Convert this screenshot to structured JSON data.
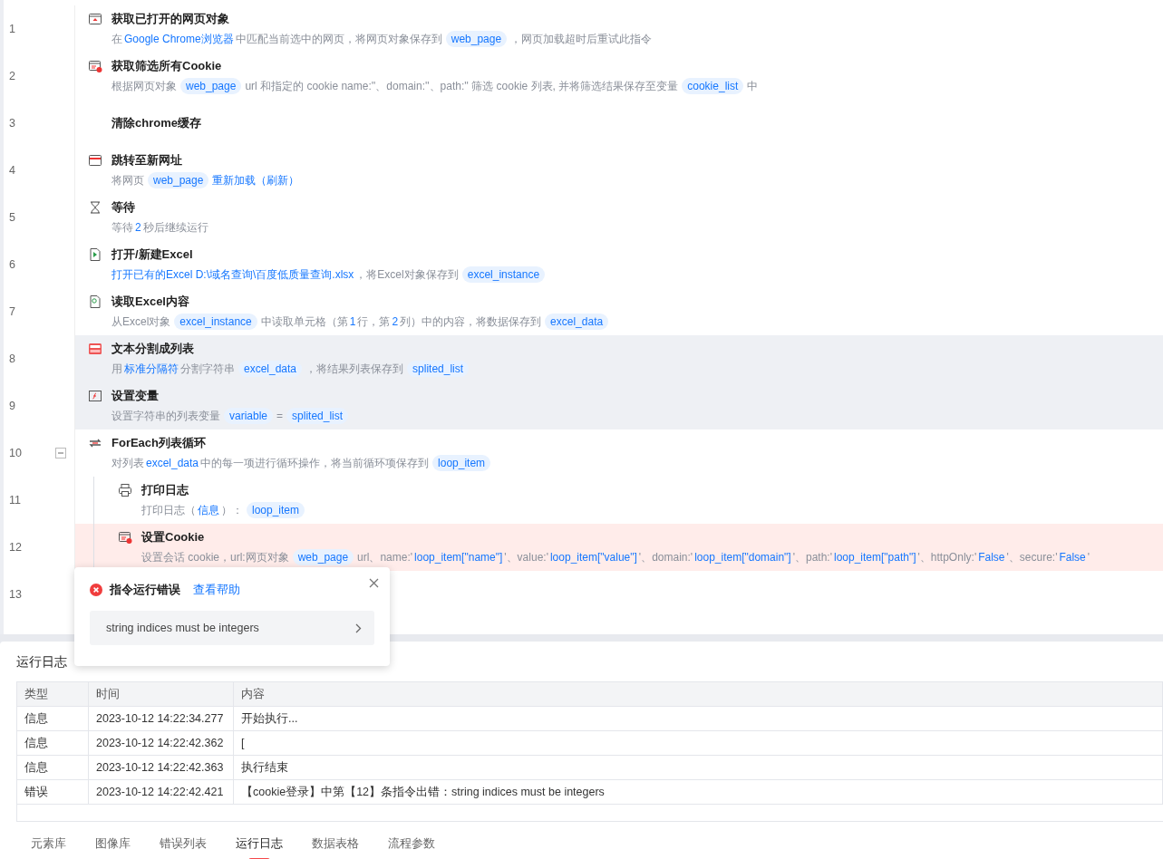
{
  "steps": [
    {
      "number": "1",
      "kind": "open_page",
      "title": "获取已打开的网页对象",
      "selected": false,
      "error": false,
      "desc": [
        {
          "kind": "text",
          "text": "在"
        },
        {
          "kind": "param",
          "text": "Google Chrome浏览器"
        },
        {
          "kind": "text",
          "text": "中匹配当前选中的网页，将网页对象保存到"
        },
        {
          "kind": "var",
          "text": "web_page"
        },
        {
          "kind": "text",
          "text": "，网页加载超时后重试此指令"
        }
      ]
    },
    {
      "number": "2",
      "kind": "get_cookie",
      "title": "获取筛选所有Cookie",
      "selected": false,
      "error": false,
      "desc": [
        {
          "kind": "text",
          "text": "根据网页对象"
        },
        {
          "kind": "var",
          "text": "web_page"
        },
        {
          "kind": "text",
          "text": "url 和指定的 cookie name:''、domain:''、path:'' 筛选 cookie 列表, 并将筛选结果保存至变量"
        },
        {
          "kind": "var",
          "text": "cookie_list"
        },
        {
          "kind": "text",
          "text": "中"
        }
      ]
    },
    {
      "number": "3",
      "kind": "clear_cache",
      "title": "清除chrome缓存",
      "selected": false,
      "error": false
    },
    {
      "number": "4",
      "kind": "navigate",
      "title": "跳转至新网址",
      "selected": false,
      "error": false,
      "desc": [
        {
          "kind": "text",
          "text": "将网页"
        },
        {
          "kind": "var",
          "text": "web_page"
        },
        {
          "kind": "param",
          "text": "重新加载（刷新）"
        }
      ]
    },
    {
      "number": "5",
      "kind": "wait",
      "title": "等待",
      "selected": false,
      "error": false,
      "desc": [
        {
          "kind": "text",
          "text": "等待"
        },
        {
          "kind": "param",
          "text": "2"
        },
        {
          "kind": "text",
          "text": "秒后继续运行"
        }
      ]
    },
    {
      "number": "6",
      "kind": "open_excel",
      "title": "打开/新建Excel",
      "selected": false,
      "error": false,
      "desc": [
        {
          "kind": "param",
          "text": "打开已有的Excel D:\\域名查询\\百度低质量查询.xlsx"
        },
        {
          "kind": "text",
          "text": "，将Excel对象保存到"
        },
        {
          "kind": "var",
          "text": "excel_instance"
        }
      ]
    },
    {
      "number": "7",
      "kind": "read_excel",
      "title": "读取Excel内容",
      "selected": false,
      "error": false,
      "desc": [
        {
          "kind": "text",
          "text": "从Excel对象"
        },
        {
          "kind": "var",
          "text": "excel_instance"
        },
        {
          "kind": "text",
          "text": "中读取单元格（第"
        },
        {
          "kind": "param",
          "text": "1"
        },
        {
          "kind": "text",
          "text": "行，第"
        },
        {
          "kind": "param",
          "text": "2"
        },
        {
          "kind": "text",
          "text": "列）中的内容，将数据保存到"
        },
        {
          "kind": "var",
          "text": "excel_data"
        }
      ]
    },
    {
      "number": "8",
      "kind": "split_text",
      "title": "文本分割成列表",
      "selected": true,
      "error": false,
      "desc": [
        {
          "kind": "text",
          "text": "用"
        },
        {
          "kind": "param",
          "text": "标准分隔符"
        },
        {
          "kind": "text",
          "text": "分割字符串"
        },
        {
          "kind": "var",
          "text": "excel_data"
        },
        {
          "kind": "text",
          "text": "，将结果列表保存到"
        },
        {
          "kind": "var",
          "text": "splited_list"
        }
      ]
    },
    {
      "number": "9",
      "kind": "set_variable",
      "title": "设置变量",
      "selected": true,
      "error": false,
      "desc": [
        {
          "kind": "text",
          "text": "设置字符串的列表变量"
        },
        {
          "kind": "var",
          "text": "variable"
        },
        {
          "kind": "text",
          "text": "="
        },
        {
          "kind": "var",
          "text": "splited_list"
        }
      ]
    },
    {
      "number": "10",
      "kind": "foreach",
      "title": "ForEach列表循环",
      "selected": false,
      "error": false,
      "expanded": true,
      "desc": [
        {
          "kind": "text",
          "text": "对列表"
        },
        {
          "kind": "param",
          "text": "excel_data"
        },
        {
          "kind": "text",
          "text": "中的每一项进行循环操作，将当前循环项保存到"
        },
        {
          "kind": "var",
          "text": "loop_item"
        }
      ],
      "children": [
        {
          "number": "11",
          "kind": "log",
          "title": "打印日志",
          "selected": false,
          "error": false,
          "desc": [
            {
              "kind": "text",
              "text": "打印日志（"
            },
            {
              "kind": "param",
              "text": "信息"
            },
            {
              "kind": "text",
              "text": "）："
            },
            {
              "kind": "var",
              "text": "loop_item"
            }
          ]
        },
        {
          "number": "12",
          "kind": "set_cookie",
          "title": "设置Cookie",
          "selected": false,
          "error": true,
          "desc": [
            {
              "kind": "text",
              "text": "设置会话 cookie，url:网页对象"
            },
            {
              "kind": "var",
              "text": "web_page"
            },
            {
              "kind": "text",
              "text": "url、name:'"
            },
            {
              "kind": "param",
              "text": "loop_item[\"name\"]"
            },
            {
              "kind": "text",
              "text": "'、value:'"
            },
            {
              "kind": "param",
              "text": "loop_item[\"value\"]"
            },
            {
              "kind": "text",
              "text": "'、domain:'"
            },
            {
              "kind": "param",
              "text": "loop_item[\"domain\"]"
            },
            {
              "kind": "text",
              "text": "'、path:'"
            },
            {
              "kind": "param",
              "text": "loop_item[\"path\"]"
            },
            {
              "kind": "text",
              "text": "'、httpOnly:'"
            },
            {
              "kind": "param",
              "text": "False"
            },
            {
              "kind": "text",
              "text": "'、secure:'"
            },
            {
              "kind": "param",
              "text": "False"
            },
            {
              "kind": "text",
              "text": "'"
            }
          ]
        }
      ]
    },
    {
      "number": "13",
      "kind": "empty"
    }
  ],
  "error_popup": {
    "title": "指令运行错误",
    "help_link": "查看帮助",
    "message": "string indices must be integers"
  },
  "log_panel": {
    "title": "运行日志",
    "columns": [
      "类型",
      "时间",
      "内容"
    ],
    "rows": [
      [
        "信息",
        "2023-10-12 14:22:34.277",
        "开始执行..."
      ],
      [
        "信息",
        "2023-10-12 14:22:42.362",
        "["
      ],
      [
        "信息",
        "2023-10-12 14:22:42.363",
        "执行结束"
      ],
      [
        "错误",
        "2023-10-12 14:22:42.421",
        "【cookie登录】中第【12】条指令出错：string indices must be integers"
      ]
    ]
  },
  "bottom_tabs": [
    {
      "label": "元素库",
      "selected": false
    },
    {
      "label": "图像库",
      "selected": false
    },
    {
      "label": "错误列表",
      "selected": false
    },
    {
      "label": "运行日志",
      "selected": true
    },
    {
      "label": "数据表格",
      "selected": false
    },
    {
      "label": "流程参数",
      "selected": false
    }
  ]
}
